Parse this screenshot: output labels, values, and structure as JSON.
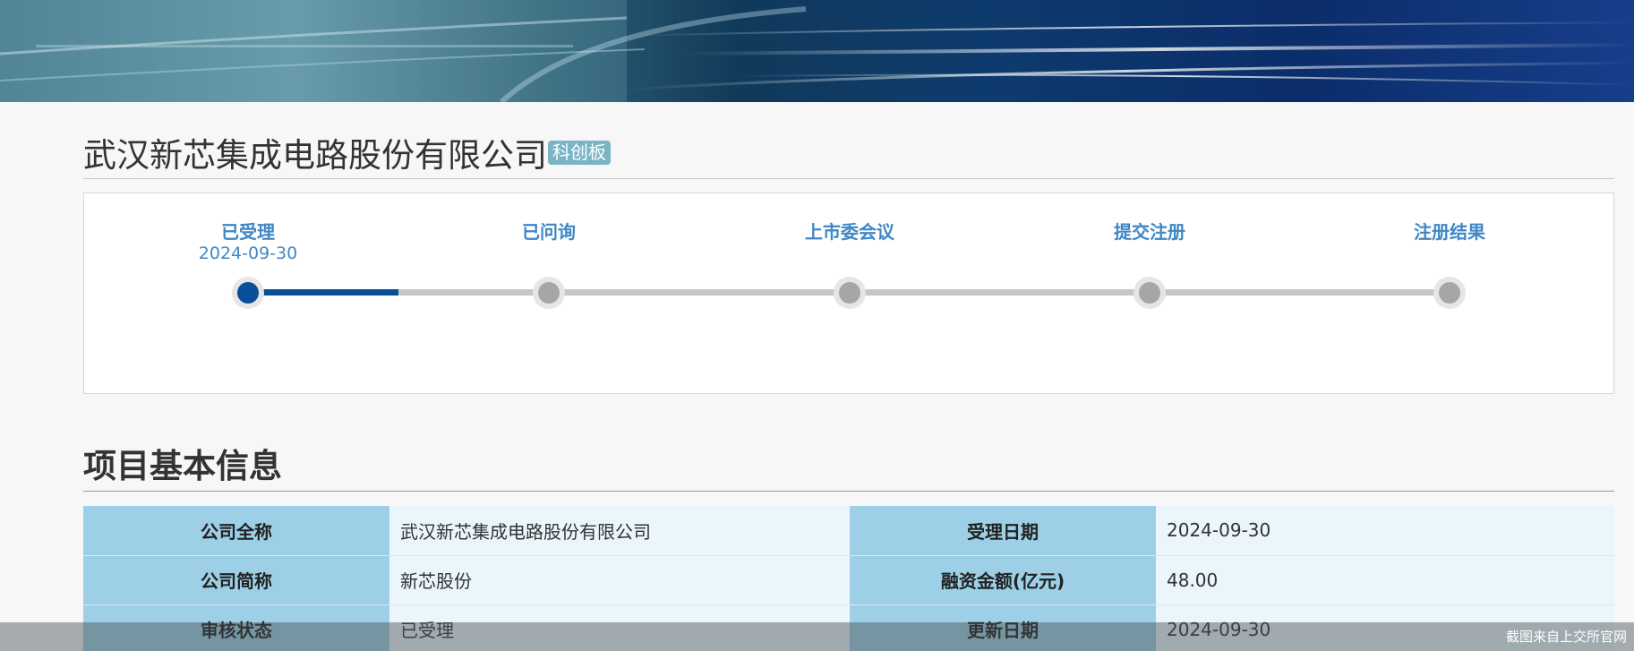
{
  "header": {
    "company_name": "武汉新芯集成电路股份有限公司",
    "board_badge": "科创板"
  },
  "progress": {
    "steps": [
      {
        "label": "已受理",
        "date": "2024-09-30",
        "active": true
      },
      {
        "label": "已问询",
        "date": "",
        "active": false
      },
      {
        "label": "上市委会议",
        "date": "",
        "active": false
      },
      {
        "label": "提交注册",
        "date": "",
        "active": false
      },
      {
        "label": "注册结果",
        "date": "",
        "active": false
      }
    ],
    "active_color": "#0a4e99",
    "inactive_color": "#a6a6a6"
  },
  "section": {
    "title": "项目基本信息"
  },
  "info_table": {
    "rows": [
      {
        "k1": "公司全称",
        "v1": "武汉新芯集成电路股份有限公司",
        "k2": "受理日期",
        "v2": "2024-09-30"
      },
      {
        "k1": "公司简称",
        "v1": "新芯股份",
        "k2": "融资金额(亿元)",
        "v2": "48.00"
      },
      {
        "k1": "审核状态",
        "v1": "已受理",
        "k2": "更新日期",
        "v2": "2024-09-30"
      }
    ]
  },
  "watermark": "截图来自上交所官网"
}
